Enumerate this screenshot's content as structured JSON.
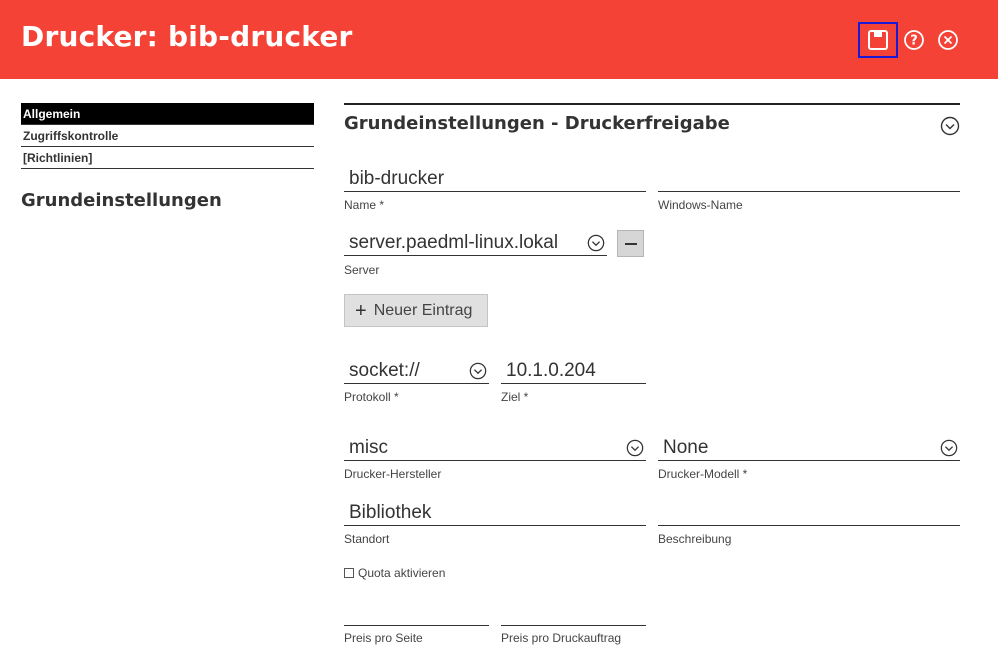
{
  "header": {
    "title": "Drucker: bib-drucker",
    "icons": {
      "save": "save-icon",
      "help": "help-icon",
      "close": "close-icon"
    },
    "bg_color": "#f44336",
    "highlight_color": "#1a1ad6"
  },
  "nav": {
    "items": [
      {
        "label": "Allgemein",
        "active": true
      },
      {
        "label": "Zugriffskontrolle",
        "active": false
      },
      {
        "label": "[Richtlinien]",
        "active": false
      }
    ],
    "heading": "Grundeinstellungen"
  },
  "section": {
    "title": "Grundeinstellungen - Druckerfreigabe",
    "toggle_icon": "chevron-down-circle-icon"
  },
  "form": {
    "name": {
      "value": "bib-drucker",
      "label": "Name *"
    },
    "windows_name": {
      "value": "",
      "label": "Windows-Name"
    },
    "server": {
      "value": "server.paedml-linux.lokal",
      "label": "Server"
    },
    "add_entry": {
      "label": "Neuer Eintrag"
    },
    "protocol": {
      "value": "socket://",
      "label": "Protokoll *"
    },
    "target": {
      "value": "10.1.0.204",
      "label": "Ziel *"
    },
    "manufacturer": {
      "value": "misc",
      "label": "Drucker-Hersteller"
    },
    "model": {
      "value": "None",
      "label": "Drucker-Modell *"
    },
    "location": {
      "value": "Bibliothek",
      "label": "Standort"
    },
    "description": {
      "value": "",
      "label": "Beschreibung"
    },
    "quota": {
      "label": "Quota aktivieren",
      "checked": false
    },
    "price_page": {
      "value": "",
      "label": "Preis pro Seite"
    },
    "price_job": {
      "value": "",
      "label": "Preis pro Druckauftrag"
    }
  }
}
